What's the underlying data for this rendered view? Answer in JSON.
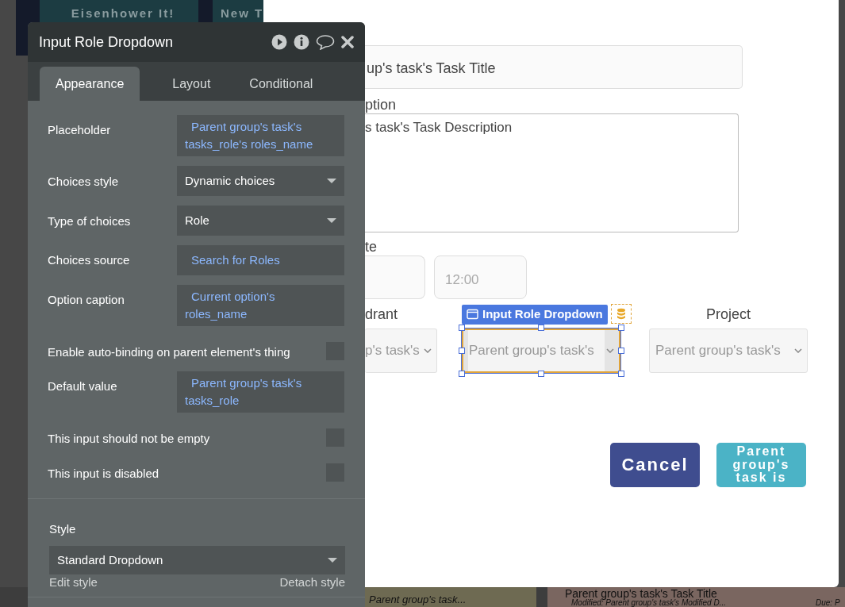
{
  "background": {
    "header_buttons": [
      "Eisenhower It!",
      "New T"
    ],
    "cards": [
      {
        "kind": "short",
        "text": "Parent group's task..."
      },
      {
        "kind": "wide",
        "title": "Parent group's task's Task Title",
        "subtitle": "Modified: Parent group's task's Modified D...",
        "due": "Due: P"
      }
    ]
  },
  "panel": {
    "title": "Input Role Dropdown",
    "tabs": [
      {
        "label": "Appearance",
        "selected": true
      },
      {
        "label": "Layout",
        "selected": false
      },
      {
        "label": "Conditional",
        "selected": false
      }
    ],
    "properties": [
      {
        "kind": "expression",
        "label": "Placeholder",
        "value": "Parent group's task's tasks_role's roles_name"
      },
      {
        "kind": "dropdown",
        "label": "Choices style",
        "value": "Dynamic choices"
      },
      {
        "kind": "dropdown",
        "label": "Type of choices",
        "value": "Role"
      },
      {
        "kind": "expression",
        "label": "Choices source",
        "value": "Search for Roles"
      },
      {
        "kind": "expression",
        "label": "Option caption",
        "value": "Current option's roles_name"
      },
      {
        "kind": "checkbox",
        "label": "Enable auto-binding on parent element's thing",
        "checked": false
      },
      {
        "kind": "expression",
        "label": "Default value",
        "value": "Parent group's task's tasks_role"
      },
      {
        "kind": "checkbox",
        "label": "This input should not be empty",
        "checked": false
      },
      {
        "kind": "checkbox",
        "label": "This input is disabled",
        "checked": false
      }
    ],
    "style": {
      "label": "Style",
      "value": "Standard Dropdown",
      "edit": "Edit style",
      "detach": "Detach style"
    }
  },
  "modal": {
    "title_value": "up's task's Task Title",
    "description_label": "ption",
    "description_value": "s task's Task Description",
    "date_label": "te",
    "time_value": "12:00",
    "dropdowns": [
      {
        "label": "drant",
        "value": "p's task's",
        "selected": false
      },
      {
        "value": "Parent group's task's",
        "selected": true,
        "tag": "Input Role Dropdown"
      },
      {
        "label": "Project",
        "value": "Parent group's task's",
        "selected": false
      }
    ],
    "buttons": [
      {
        "kind": "cancel",
        "label": "Cancel"
      },
      {
        "kind": "confirm",
        "label": "Parent group's task is"
      }
    ]
  }
}
